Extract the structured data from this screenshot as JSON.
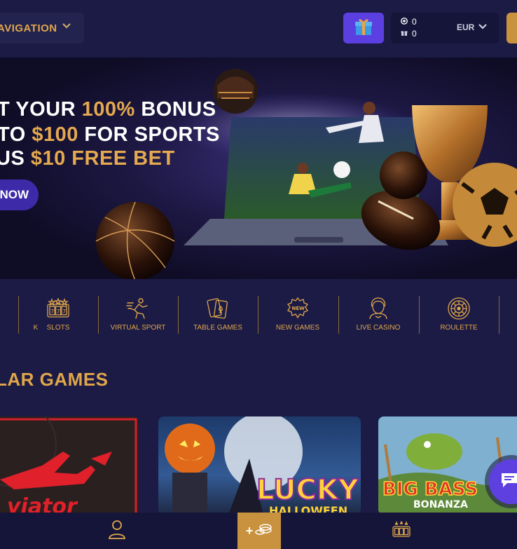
{
  "header": {
    "nav_label": "AVIGATION",
    "gift_icon": "gift-icon",
    "balance_value": "0",
    "bonus_value": "0",
    "currency": "EUR"
  },
  "banner": {
    "line1_a": "T YOUR ",
    "line1_b": "100%",
    "line1_c": " BONUS",
    "line2_a": "TO ",
    "line2_b": "$100",
    "line2_c": " FOR SPORTS",
    "line3_a": "US ",
    "line3_b": "$10 FREE BET",
    "cta_label": "NOW"
  },
  "categories": [
    {
      "label": "K",
      "icon": "partial-icon"
    },
    {
      "label": "SLOTS",
      "icon": "slots-icon"
    },
    {
      "label": "VIRTUAL SPORT",
      "icon": "runner-icon"
    },
    {
      "label": "TABLE GAMES",
      "icon": "cards-icon"
    },
    {
      "label": "NEW GAMES",
      "icon": "new-badge-icon"
    },
    {
      "label": "LIVE CASINO",
      "icon": "dealer-icon"
    },
    {
      "label": "ROULETTE",
      "icon": "roulette-icon"
    }
  ],
  "popular": {
    "title": "LAR GAMES",
    "games": [
      {
        "title": "viator"
      },
      {
        "title": "LUCKY",
        "subtitle": "HALLOWEEN"
      },
      {
        "title": "BIG BASS",
        "subtitle": "BONANZA"
      }
    ]
  },
  "bottom_bar": {
    "deposit_label": "+"
  },
  "colors": {
    "background": "#1b1b45",
    "accent_gold": "#e0a64b",
    "purple": "#5b3fe0"
  }
}
